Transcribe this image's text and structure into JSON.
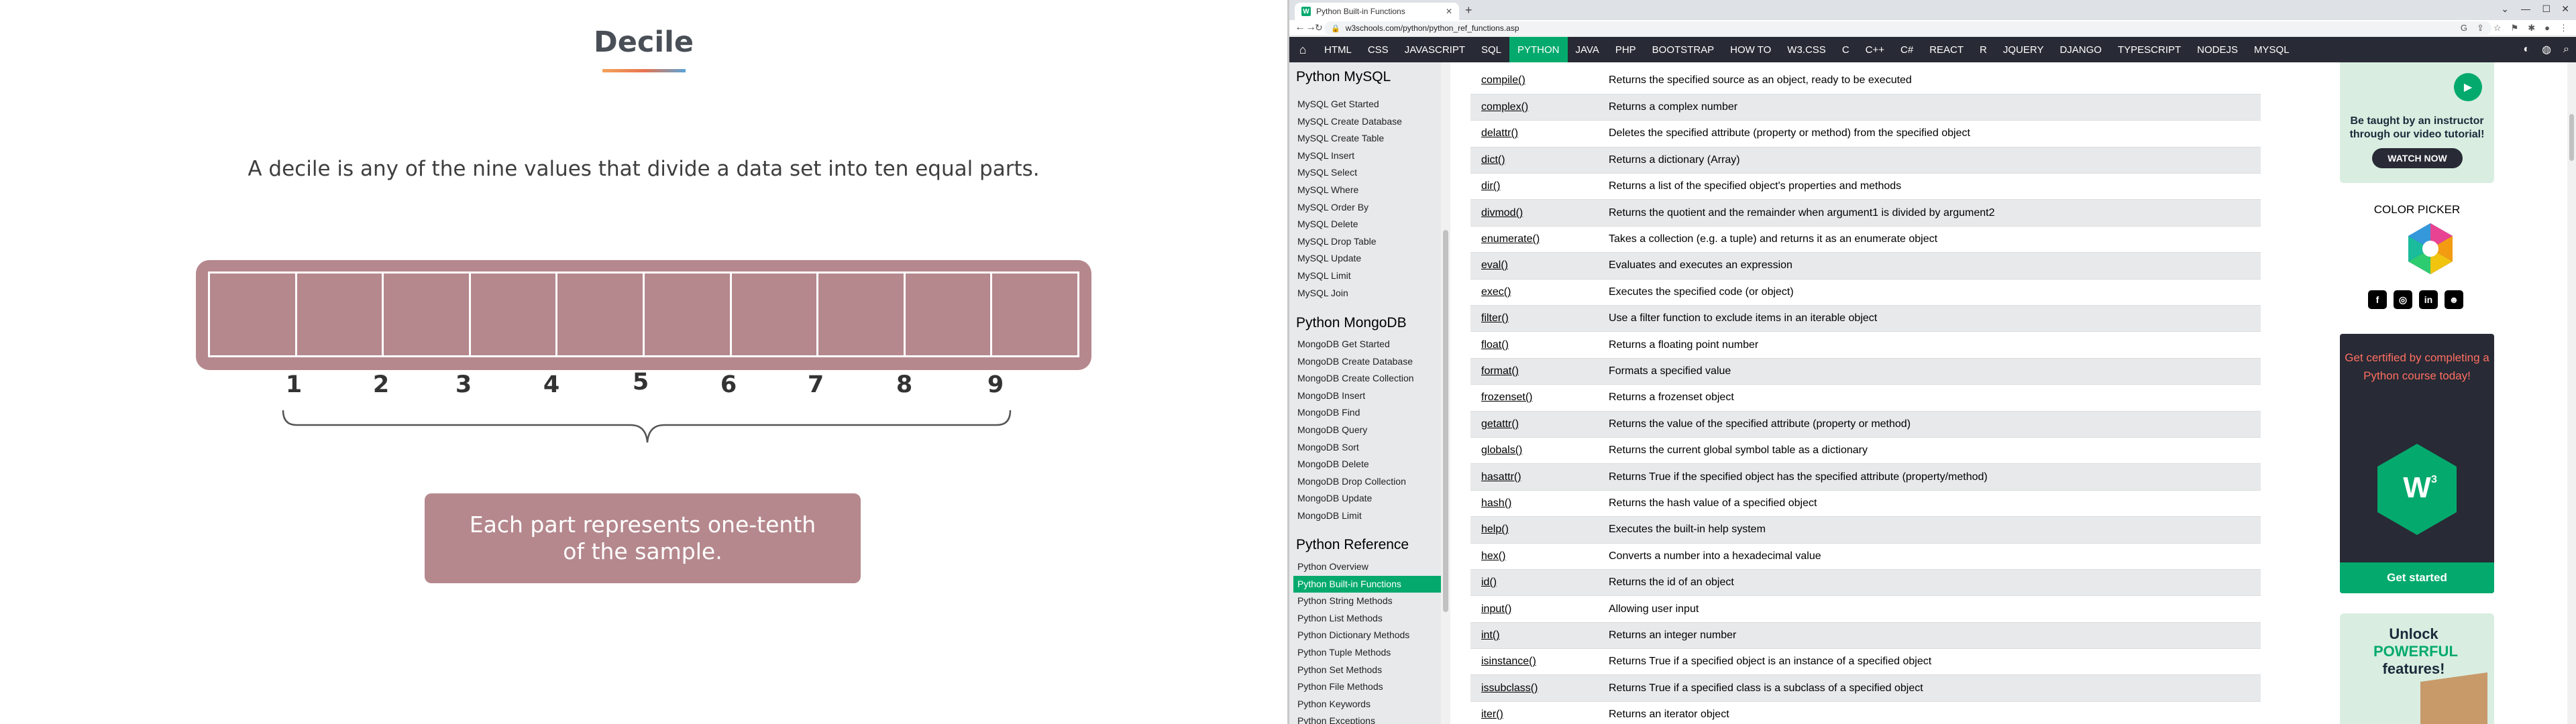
{
  "slide": {
    "title": "Decile",
    "definition": "A decile is any of the nine values that divide a data set into ten equal parts.",
    "decile_labels": [
      "1",
      "2",
      "3",
      "4",
      "5",
      "6",
      "7",
      "8",
      "9"
    ],
    "caption": "Each part represents one-tenth of the sample.",
    "colors": {
      "box": "#b5888d",
      "text": "#3e3e3e"
    }
  },
  "browser": {
    "tab_title": "Python Built-in Functions",
    "url": "w3schools.com/python/python_ref_functions.asp",
    "nav": [
      "HTML",
      "CSS",
      "JAVASCRIPT",
      "SQL",
      "PYTHON",
      "JAVA",
      "PHP",
      "BOOTSTRAP",
      "HOW TO",
      "W3.CSS",
      "C",
      "C++",
      "C#",
      "REACT",
      "R",
      "JQUERY",
      "DJANGO",
      "TYPESCRIPT",
      "NODEJS",
      "MYSQL"
    ],
    "nav_active": "PYTHON",
    "sidebar": {
      "mysql_heading": "Python MySQL",
      "mysql_items": [
        "MySQL Get Started",
        "MySQL Create Database",
        "MySQL Create Table",
        "MySQL Insert",
        "MySQL Select",
        "MySQL Where",
        "MySQL Order By",
        "MySQL Delete",
        "MySQL Drop Table",
        "MySQL Update",
        "MySQL Limit",
        "MySQL Join"
      ],
      "mongo_heading": "Python MongoDB",
      "mongo_items": [
        "MongoDB Get Started",
        "MongoDB Create Database",
        "MongoDB Create Collection",
        "MongoDB Insert",
        "MongoDB Find",
        "MongoDB Query",
        "MongoDB Sort",
        "MongoDB Delete",
        "MongoDB Drop Collection",
        "MongoDB Update",
        "MongoDB Limit"
      ],
      "ref_heading": "Python Reference",
      "ref_items": [
        "Python Overview",
        "Python Built-in Functions",
        "Python String Methods",
        "Python List Methods",
        "Python Dictionary Methods",
        "Python Tuple Methods",
        "Python Set Methods",
        "Python File Methods",
        "Python Keywords",
        "Python Exceptions"
      ],
      "ref_active": "Python Built-in Functions"
    },
    "functions": [
      {
        "name": "compile()",
        "desc": "Returns the specified source as an object, ready to be executed"
      },
      {
        "name": "complex()",
        "desc": "Returns a complex number"
      },
      {
        "name": "delattr()",
        "desc": "Deletes the specified attribute (property or method) from the specified object"
      },
      {
        "name": "dict()",
        "desc": "Returns a dictionary (Array)"
      },
      {
        "name": "dir()",
        "desc": "Returns a list of the specified object's properties and methods"
      },
      {
        "name": "divmod()",
        "desc": "Returns the quotient and the remainder when argument1 is divided by argument2"
      },
      {
        "name": "enumerate()",
        "desc": "Takes a collection (e.g. a tuple) and returns it as an enumerate object"
      },
      {
        "name": "eval()",
        "desc": "Evaluates and executes an expression"
      },
      {
        "name": "exec()",
        "desc": "Executes the specified code (or object)"
      },
      {
        "name": "filter()",
        "desc": "Use a filter function to exclude items in an iterable object"
      },
      {
        "name": "float()",
        "desc": "Returns a floating point number"
      },
      {
        "name": "format()",
        "desc": "Formats a specified value"
      },
      {
        "name": "frozenset()",
        "desc": "Returns a frozenset object"
      },
      {
        "name": "getattr()",
        "desc": "Returns the value of the specified attribute (property or method)"
      },
      {
        "name": "globals()",
        "desc": "Returns the current global symbol table as a dictionary"
      },
      {
        "name": "hasattr()",
        "desc": "Returns True if the specified object has the specified attribute (property/method)"
      },
      {
        "name": "hash()",
        "desc": "Returns the hash value of a specified object"
      },
      {
        "name": "help()",
        "desc": "Executes the built-in help system"
      },
      {
        "name": "hex()",
        "desc": "Converts a number into a hexadecimal value"
      },
      {
        "name": "id()",
        "desc": "Returns the id of an object"
      },
      {
        "name": "input()",
        "desc": "Allowing user input"
      },
      {
        "name": "int()",
        "desc": "Returns an integer number"
      },
      {
        "name": "isinstance()",
        "desc": "Returns True if a specified object is an instance of a specified object"
      },
      {
        "name": "issubclass()",
        "desc": "Returns True if a specified class is a subclass of a specified object"
      },
      {
        "name": "iter()",
        "desc": "Returns an iterator object"
      }
    ],
    "ads": {
      "video_text": "Be taught by an instructor through our video tutorial!",
      "watch_now": "WATCH NOW",
      "color_picker": "COLOR PICKER",
      "cert_text": "Get certified by completing a Python course today!",
      "get_started": "Get started",
      "unlock_1": "Unlock",
      "unlock_2": "POWERFUL",
      "unlock_3": "features!"
    }
  }
}
